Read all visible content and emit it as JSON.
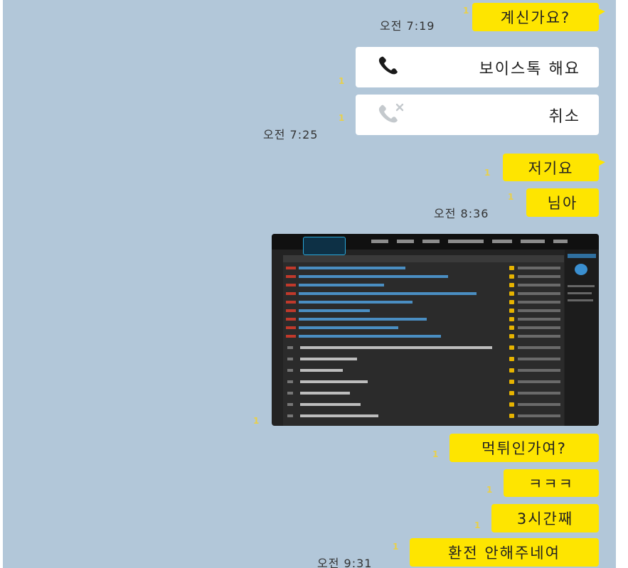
{
  "messages": {
    "m1": {
      "text": "계신가요?",
      "unread": "1",
      "time": "오전 7:19"
    },
    "voice_request": {
      "text": "보이스톡 해요",
      "unread": "1",
      "icon": "phone-icon"
    },
    "voice_cancel": {
      "text": "취소",
      "unread": "1",
      "time": "오전 7:25",
      "icon": "phone-cancel-icon"
    },
    "m2": {
      "text": "저기요",
      "unread": "1"
    },
    "m3": {
      "text": "님아",
      "unread": "1",
      "time": "오전 8:36"
    },
    "photo": {
      "unread": "1"
    },
    "m4": {
      "text": "먹튀인가여?",
      "unread": "1"
    },
    "m5": {
      "text": "ㅋㅋㅋ",
      "unread": "1"
    },
    "m6": {
      "text": "3시간째",
      "unread": "1"
    },
    "m7": {
      "text": "환전 안해주네여",
      "unread": "1",
      "time": "오전 9:31"
    }
  },
  "colors": {
    "chat_background": "#b2c7d9",
    "my_bubble": "#fee500",
    "card_background": "#ffffff",
    "unread_count": "#e8d04a"
  }
}
